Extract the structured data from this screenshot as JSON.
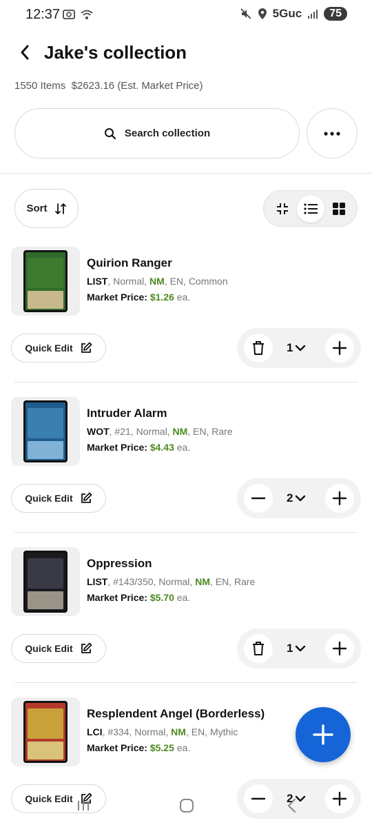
{
  "status_bar": {
    "time": "12:37",
    "network": "5Guc",
    "battery": "75"
  },
  "header": {
    "title": "Jake's collection"
  },
  "summary": {
    "items": "1550 Items",
    "price": "$2623.16",
    "price_note": "(Est. Market Price)"
  },
  "search": {
    "label": "Search collection"
  },
  "toolbar": {
    "sort_label": "Sort",
    "active_view": "list"
  },
  "items": [
    {
      "name": "Quirion Ranger",
      "set": "LIST",
      "rest": ", Normal, ",
      "condition": "NM",
      "tail": ", EN, Common",
      "price_label": "Market Price:",
      "price": "$1.26",
      "ea": "ea.",
      "qty": "1",
      "left_action": "trash",
      "quick_edit": "Quick Edit",
      "art_color": "#3f7a2e",
      "frame_color": "#2f6b2b",
      "text_color": "#c9b98e"
    },
    {
      "name": "Intruder Alarm",
      "set": "WOT",
      "rest": ", #21, Normal, ",
      "condition": "NM",
      "tail": ", EN, Rare",
      "price_label": "Market Price:",
      "price": "$4.43",
      "ea": "ea.",
      "qty": "2",
      "left_action": "minus",
      "quick_edit": "Quick Edit",
      "art_color": "#3b7fb0",
      "frame_color": "#1f5c8c",
      "text_color": "#7fb2d4"
    },
    {
      "name": "Oppression",
      "set": "LIST",
      "rest": ", #143/350, Normal, ",
      "condition": "NM",
      "tail": ", EN, Rare",
      "price_label": "Market Price:",
      "price": "$5.70",
      "ea": "ea.",
      "qty": "1",
      "left_action": "trash",
      "quick_edit": "Quick Edit",
      "art_color": "#3a3a46",
      "frame_color": "#1b1b1f",
      "text_color": "#9a9488"
    },
    {
      "name": "Resplendent Angel (Borderless)",
      "set": "LCI",
      "rest": ", #334, Normal, ",
      "condition": "NM",
      "tail": ", EN, Mythic",
      "price_label": "Market Price:",
      "price": "$5.25",
      "ea": "ea.",
      "qty": "2",
      "left_action": "minus",
      "quick_edit": "Quick Edit",
      "art_color": "#c9a13a",
      "frame_color": "#b33a2a",
      "text_color": "#d9c27a"
    }
  ],
  "colors": {
    "accent": "#1565d8",
    "price_green": "#4e8a1f"
  }
}
